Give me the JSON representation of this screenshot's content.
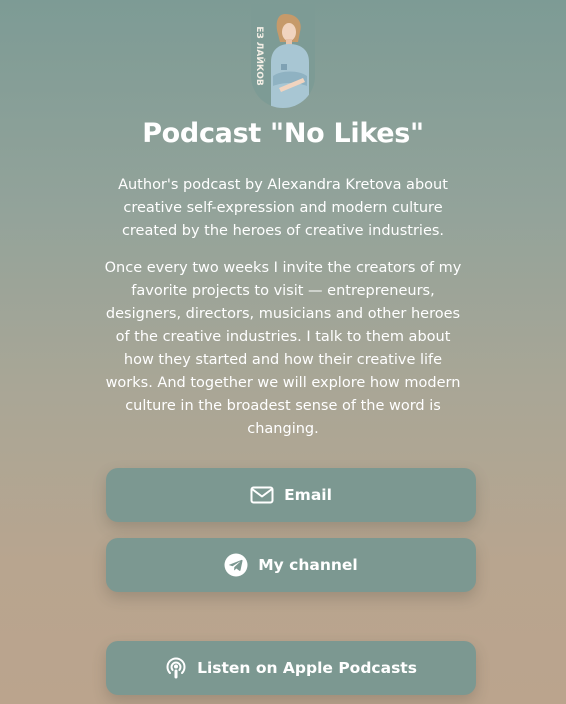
{
  "profile": {
    "avatar_text": "ЕЗ ЛАЙКОВ",
    "title": "Podcast \"No Likes\"",
    "intro": "Author's podcast by Alexandra Kretova about creative self-expression and modern culture created by the heroes of creative industries.",
    "description": "Once every two weeks I invite the creators of my favorite projects to visit — entrepreneurs, designers, directors, musicians and other heroes of the creative industries. I talk to them about how they started and how their creative life works. And together we will explore how modern culture in the broadest sense of the word is changing."
  },
  "links": [
    {
      "label": "Email",
      "icon": "mail-icon"
    },
    {
      "label": "My channel",
      "icon": "telegram-icon"
    },
    {
      "label": "Listen on Apple Podcasts",
      "icon": "podcast-icon"
    }
  ],
  "colors": {
    "background_top": "#7d9b95",
    "background_bottom": "#bba48d",
    "button": "#7c9891",
    "text": "#ffffff"
  }
}
